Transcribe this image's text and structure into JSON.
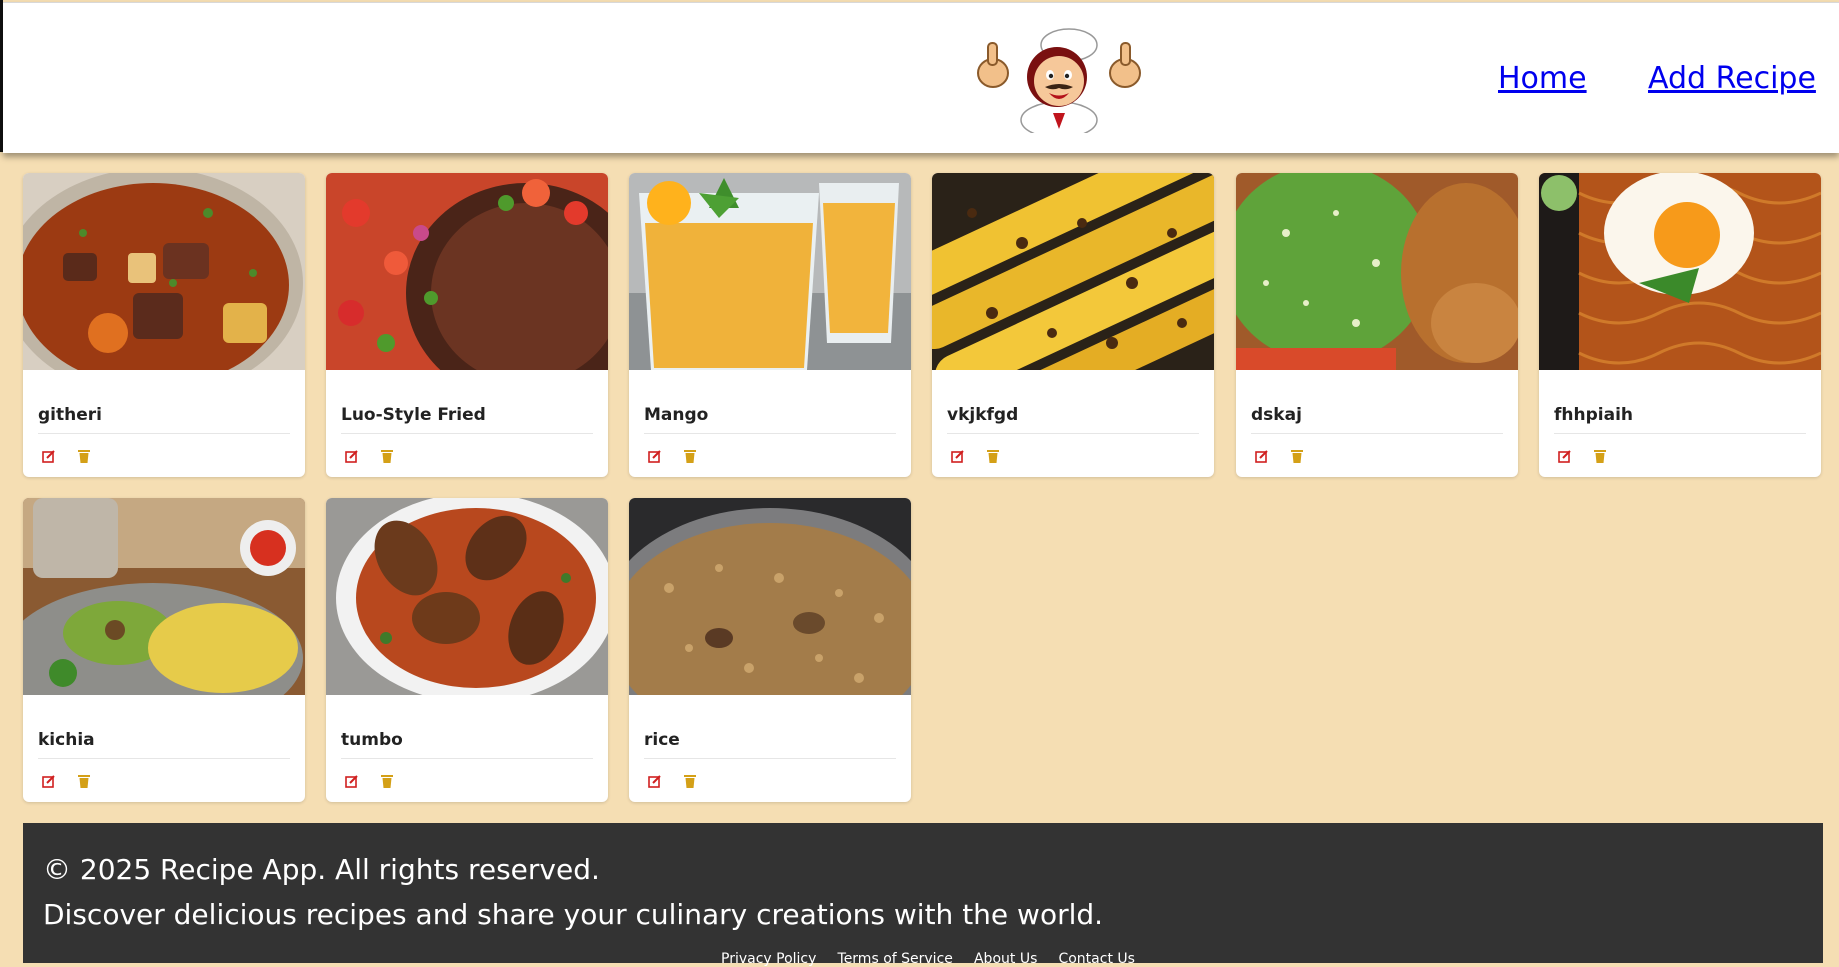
{
  "header": {
    "logo_alt": "Chef mascot logo",
    "nav": {
      "home": "Home",
      "add_recipe": "Add Recipe"
    }
  },
  "recipes": [
    {
      "title": "githeri",
      "image": "beef-potato-stew"
    },
    {
      "title": "Luo-Style Fried",
      "image": "fried-fish-kachumbari"
    },
    {
      "title": "Mango",
      "image": "mango-juice"
    },
    {
      "title": "vkjkfgd",
      "image": "roasted-maize"
    },
    {
      "title": "dskaj",
      "image": "mukimo-chicken"
    },
    {
      "title": "fhhpiaih",
      "image": "noodles-fried-egg"
    },
    {
      "title": "kichia",
      "image": "omelette-avocado"
    },
    {
      "title": "tumbo",
      "image": "jollof-chicken"
    },
    {
      "title": "rice",
      "image": "pilau-rice"
    }
  ],
  "card_actions": {
    "edit_icon": "edit-icon",
    "delete_icon": "trash-icon"
  },
  "footer": {
    "copyright": "© 2025 Recipe App. All rights reserved.",
    "tagline": "Discover delicious recipes and share your culinary creations with the world.",
    "links": [
      "Privacy Policy",
      "Terms of Service",
      "About Us",
      "Contact Us"
    ]
  },
  "colors": {
    "page_bg": "#f5deb3",
    "header_bg": "#ffffff",
    "nav_link": "#0000ee",
    "footer_bg": "#333333",
    "edit_icon": "#d02020",
    "delete_icon": "#d4a017"
  }
}
